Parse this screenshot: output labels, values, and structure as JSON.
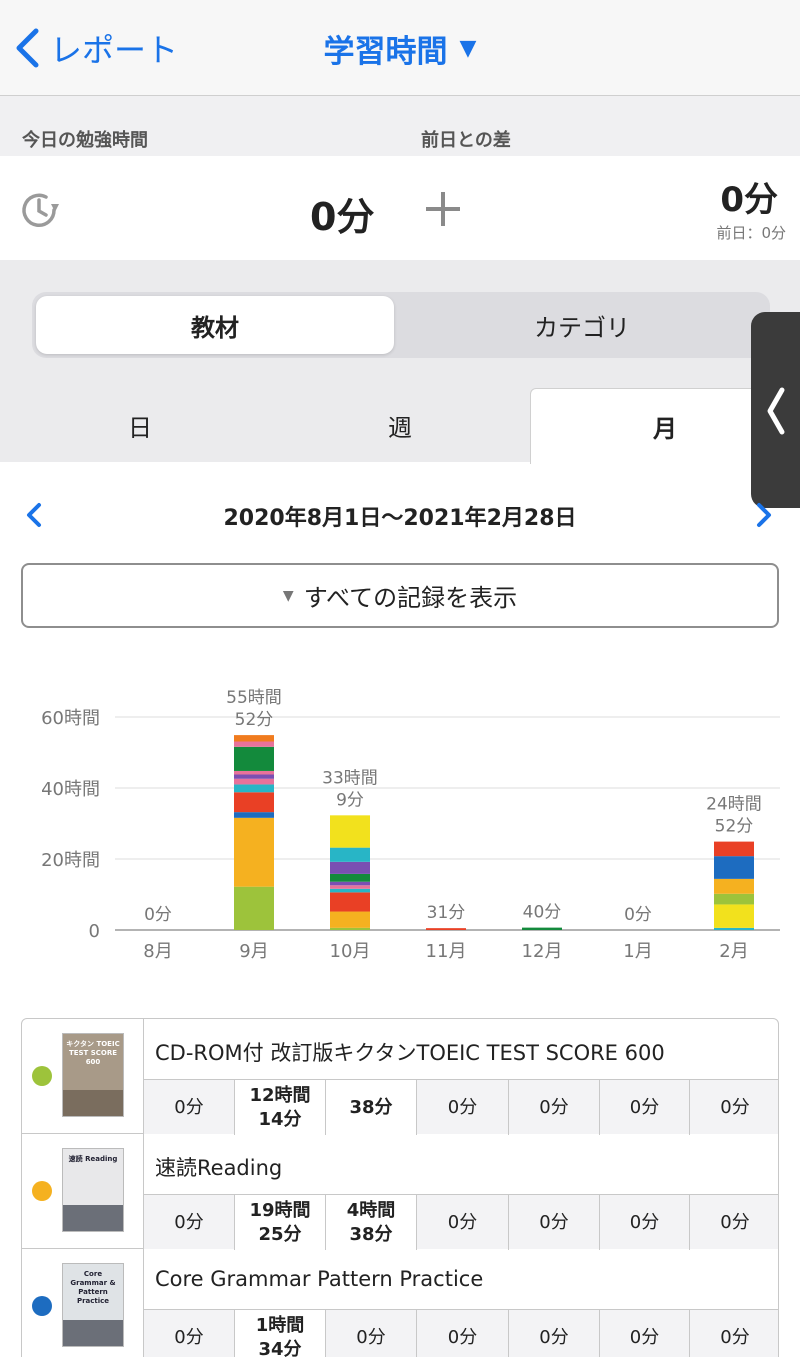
{
  "nav": {
    "back_label": "レポート",
    "title": "学習時間"
  },
  "stats": {
    "today_label": "今日の勉強時間",
    "diff_label": "前日との差",
    "today_value": "0分",
    "diff_value": "0分",
    "prev_day": "前日：0分"
  },
  "segment": {
    "left": "教材",
    "right": "カテゴリ"
  },
  "period_tabs": {
    "day": "日",
    "week": "週",
    "month": "月"
  },
  "date_range": "2020年8月1日〜2021年2月28日",
  "filter_label": "すべての記録を表示",
  "colors": {
    "accent": "#1a73e8"
  },
  "chart_data": {
    "type": "bar",
    "stacked": true,
    "categories": [
      "8月",
      "9月",
      "10月",
      "11月",
      "12月",
      "1月",
      "2月"
    ],
    "totals_minutes": [
      0,
      3352,
      1989,
      31,
      40,
      0,
      1492
    ],
    "total_labels": [
      [
        "0分"
      ],
      [
        "55時間",
        "52分"
      ],
      [
        "33時間",
        "9分"
      ],
      [
        "31分"
      ],
      [
        "40分"
      ],
      [
        "0分"
      ],
      [
        "24時間",
        "52分"
      ]
    ],
    "y_ticks": [
      "0",
      "20時間",
      "40時間",
      "60時間"
    ],
    "y_tick_hours": [
      0,
      20,
      40,
      60
    ],
    "ylim_hours": [
      0,
      60
    ],
    "grid": true,
    "stacks_hours": [
      [],
      [
        {
          "color": "#9dc33b",
          "hours": 12.2
        },
        {
          "color": "#f5b120",
          "hours": 19.4
        },
        {
          "color": "#1d6cc0",
          "hours": 1.6
        },
        {
          "color": "#e94025",
          "hours": 5.6
        },
        {
          "color": "#28b5c6",
          "hours": 2.2
        },
        {
          "color": "#e7729b",
          "hours": 1.6
        },
        {
          "color": "#7a4fb2",
          "hours": 1.2
        },
        {
          "color": "#e7729b",
          "hours": 1.0
        },
        {
          "color": "#138a3c",
          "hours": 6.8
        },
        {
          "color": "#e7729b",
          "hours": 1.5
        },
        {
          "color": "#f07b1e",
          "hours": 1.8
        }
      ],
      [
        {
          "color": "#9dc33b",
          "hours": 0.6
        },
        {
          "color": "#f5b120",
          "hours": 4.6
        },
        {
          "color": "#e94025",
          "hours": 5.4
        },
        {
          "color": "#28b5c6",
          "hours": 1.0
        },
        {
          "color": "#e7729b",
          "hours": 1.0
        },
        {
          "color": "#7a4fb2",
          "hours": 1.0
        },
        {
          "color": "#138a3c",
          "hours": 2.2
        },
        {
          "color": "#7a4fb2",
          "hours": 3.4
        },
        {
          "color": "#28b5c6",
          "hours": 4.0
        },
        {
          "color": "#f2e11d",
          "hours": 9.1
        }
      ],
      [
        {
          "color": "#e94025",
          "hours": 0.52
        }
      ],
      [
        {
          "color": "#138a3c",
          "hours": 0.67
        }
      ],
      [],
      [
        {
          "color": "#28b5c6",
          "hours": 0.6
        },
        {
          "color": "#f2e11d",
          "hours": 6.6
        },
        {
          "color": "#9dc33b",
          "hours": 3.0
        },
        {
          "color": "#f5b120",
          "hours": 4.2
        },
        {
          "color": "#1d6cc0",
          "hours": 6.4
        },
        {
          "color": "#e94025",
          "hours": 4.1
        }
      ]
    ]
  },
  "materials": [
    {
      "name": "CD-ROM付 改訂版キクタンTOEIC TEST SCORE 600",
      "color": "#9dc33b",
      "cover_text": "キクタン TOEIC TEST SCORE 600",
      "cells": [
        [
          "0分"
        ],
        [
          "12時間",
          "14分"
        ],
        [
          "38分"
        ],
        [
          "0分"
        ],
        [
          "0分"
        ],
        [
          "0分"
        ],
        [
          "0分"
        ]
      ],
      "bold": [
        false,
        true,
        true,
        false,
        false,
        false,
        false
      ]
    },
    {
      "name": "速読Reading",
      "color": "#f5b120",
      "cover_text": "速読 Reading",
      "cells": [
        [
          "0分"
        ],
        [
          "19時間",
          "25分"
        ],
        [
          "4時間",
          "38分"
        ],
        [
          "0分"
        ],
        [
          "0分"
        ],
        [
          "0分"
        ],
        [
          "0分"
        ]
      ],
      "bold": [
        false,
        true,
        true,
        false,
        false,
        false,
        false
      ]
    },
    {
      "name": "Core Grammar Pattern Practice",
      "color": "#1d6cc0",
      "cover_text": "Core Grammar & Pattern Practice",
      "cells": [
        [
          "0分"
        ],
        [
          "1時間",
          "34分"
        ],
        [
          "0分"
        ],
        [
          "0分"
        ],
        [
          "0分"
        ],
        [
          "0分"
        ],
        [
          "0分"
        ]
      ],
      "bold": [
        false,
        true,
        false,
        false,
        false,
        false,
        false
      ]
    }
  ]
}
